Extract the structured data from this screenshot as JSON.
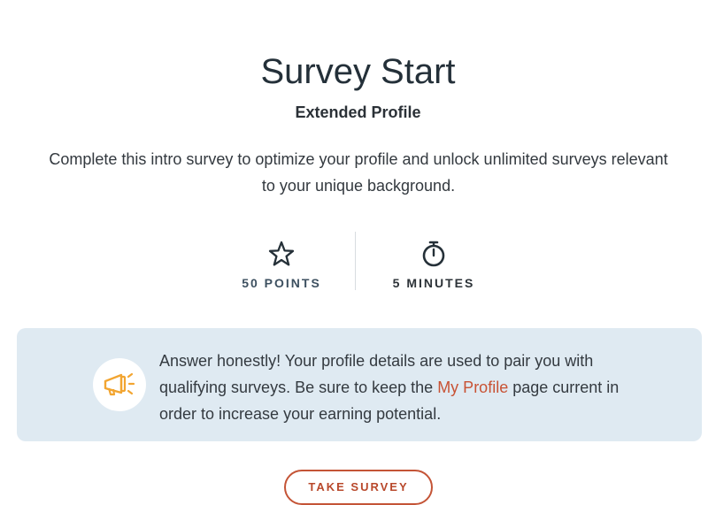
{
  "page": {
    "title": "Survey Start",
    "subtitle": "Extended Profile",
    "description": "Complete this intro survey to optimize your profile and unlock unlimited surveys relevant to your unique background."
  },
  "stats": {
    "points": {
      "label": "50 POINTS",
      "icon": "star-outline-icon"
    },
    "duration": {
      "label": "5 MINUTES",
      "icon": "stopwatch-icon"
    }
  },
  "notice": {
    "icon": "megaphone-icon",
    "text_before_link": "Answer honestly! Your profile details are used to pair you with qualifying surveys. Be sure to keep the ",
    "link_text": "My Profile",
    "text_after_link": " page current in order to increase your earning potential."
  },
  "actions": {
    "take_survey_label": "TAKE SURVEY"
  },
  "colors": {
    "accent": "#c85234",
    "notice_background": "#dfeaf2",
    "icon_orange": "#f2a531",
    "heading": "#243039"
  }
}
